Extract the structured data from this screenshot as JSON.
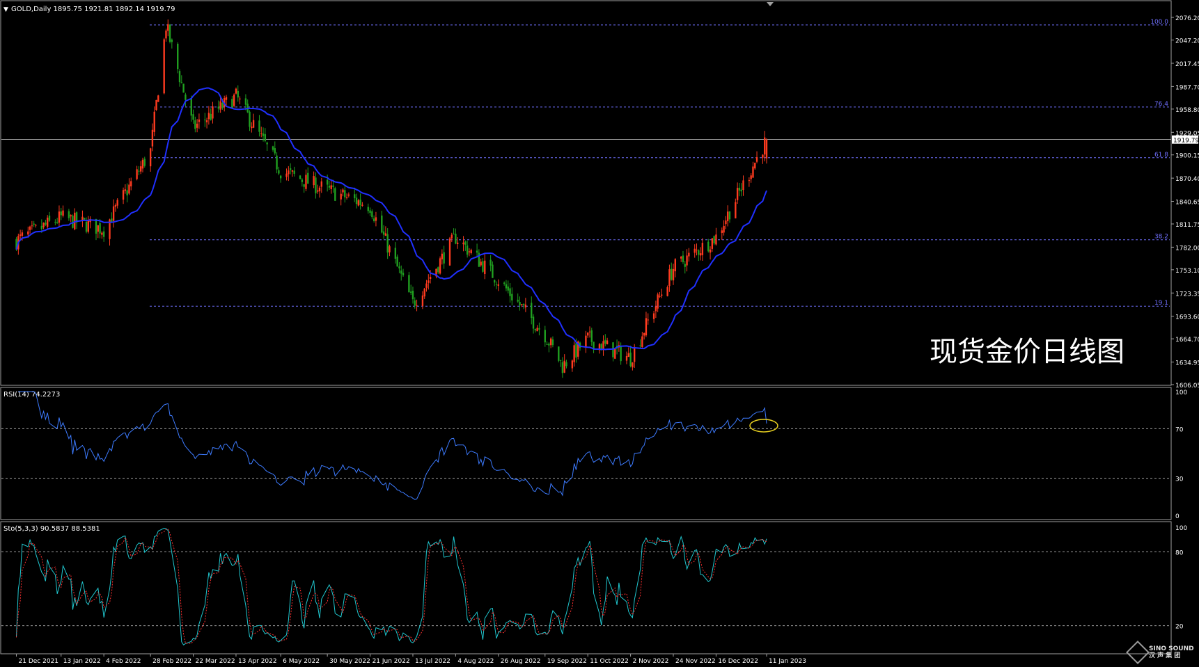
{
  "colors": {
    "background": "#000000",
    "bull": "#ff3b1f",
    "bear": "#20a020",
    "ma": "#2030ff",
    "rsi": "#3d7bff",
    "sto_main": "#20c8d0",
    "sto_signal": "#ff3030",
    "fib": "#7070ff",
    "grid_border": "#a0a0a0"
  },
  "main_panel": {
    "header": "GOLD,Daily  1895.75 1921.81 1892.14 1919.79",
    "current_price": "1919.79",
    "price_ticks": [
      "2076.20",
      "2047.20",
      "2017.45",
      "1987.70",
      "1958.80",
      "1929.05",
      "1900.15",
      "1870.40",
      "1840.65",
      "1811.75",
      "1782.00",
      "1753.10",
      "1723.35",
      "1693.60",
      "1664.70",
      "1634.95",
      "1606.05"
    ],
    "fib_levels": [
      {
        "label": "100.0",
        "price": 2066.5
      },
      {
        "label": "76.4",
        "price": 1961.5
      },
      {
        "label": "61.8",
        "price": 1896.5
      },
      {
        "label": "38.2",
        "price": 1791.5
      },
      {
        "label": "19.1",
        "price": 1706.5
      }
    ]
  },
  "overlay_text": "现货金价日线图",
  "rsi_panel": {
    "label": "RSI(14) 74.2273",
    "ticks": [
      "100",
      "70",
      "30",
      "0"
    ]
  },
  "sto_panel": {
    "label": "Sto(5,3,3) 90.5837 88.5381",
    "ticks": [
      "100",
      "80",
      "20"
    ]
  },
  "x_axis": {
    "labels": [
      "21 Dec 2021",
      "13 Jan 2022",
      "4 Feb 2022",
      "28 Feb 2022",
      "22 Mar 2022",
      "13 Apr 2022",
      "6 May 2022",
      "30 May 2022",
      "21 Jun 2022",
      "13 Jul 2022",
      "4 Aug 2022",
      "26 Aug 2022",
      "19 Sep 2022",
      "11 Oct 2022",
      "2 Nov 2022",
      "24 Nov 2022",
      "16 Dec 2022",
      "11 Jan 2023"
    ]
  },
  "logo": {
    "line1": "SINO SOUND",
    "line2": "汉 声 集 团"
  },
  "chart_data": {
    "type": "candlestick",
    "title": "GOLD,Daily",
    "ylim": [
      1606.05,
      2076.2
    ],
    "close_path": [
      [
        "21 Dec 2021",
        1790
      ],
      [
        "13 Jan 2022",
        1820
      ],
      [
        "4 Feb 2022",
        1805
      ],
      [
        "28 Feb 2022",
        1905
      ],
      [
        "8 Mar 2022",
        2066
      ],
      [
        "22 Mar 2022",
        1935
      ],
      [
        "13 Apr 2022",
        1975
      ],
      [
        "6 May 2022",
        1880
      ],
      [
        "30 May 2022",
        1855
      ],
      [
        "21 Jun 2022",
        1835
      ],
      [
        "13 Jul 2022",
        1710
      ],
      [
        "4 Aug 2022",
        1795
      ],
      [
        "26 Aug 2022",
        1740
      ],
      [
        "19 Sep 2022",
        1670
      ],
      [
        "28 Sep 2022",
        1630
      ],
      [
        "11 Oct 2022",
        1665
      ],
      [
        "2 Nov 2022",
        1640
      ],
      [
        "24 Nov 2022",
        1755
      ],
      [
        "16 Dec 2022",
        1795
      ],
      [
        "11 Jan 2023",
        1919.79
      ]
    ],
    "indicators": [
      "MA (blue)",
      "RSI(14)",
      "Stochastic(5,3,3)"
    ],
    "rsi_last": 74.2273,
    "sto_last": [
      90.5837,
      88.5381
    ]
  }
}
